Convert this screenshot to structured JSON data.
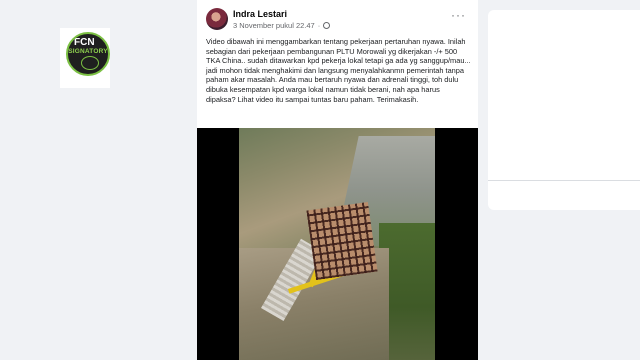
{
  "left_badge": {
    "top_text": "FCN",
    "mid_text": "SIGNATORY"
  },
  "post": {
    "author": "Indra Lestari",
    "timestamp": "3 November pukul 22.47",
    "more_label": "···",
    "text": "Video dibawah ini menggambarkan tentang pekerjaan pertaruhan nyawa. Inilah sebagian dari pekerjaan pembangunan PLTU Morowali yg dikerjakan -/+ 500 TKA China.. sudah ditawarkan kpd pekerja lokal tetapi ga ada yg sanggup/mau... jadi mohon tidak menghakimi dan langsung menyalahkanmn pemerintah tanpa paham akar masalah. Anda mau bertaruh nyawa dan adrenali tinggi, toh dulu dibuka kesempatan kpd warga lokal namun tidak berani, nah apa harus dipaksa? Lihat video itu sampai tuntas baru paham. Terimakasih."
  },
  "icons": {
    "globe": "globe-icon",
    "more": "more-options-icon",
    "badge": "fcn-signatory-badge"
  },
  "colors": {
    "background": "#f0f2f5",
    "card": "#ffffff",
    "secondary_text": "#65676b",
    "badge_green": "#7bc043"
  }
}
